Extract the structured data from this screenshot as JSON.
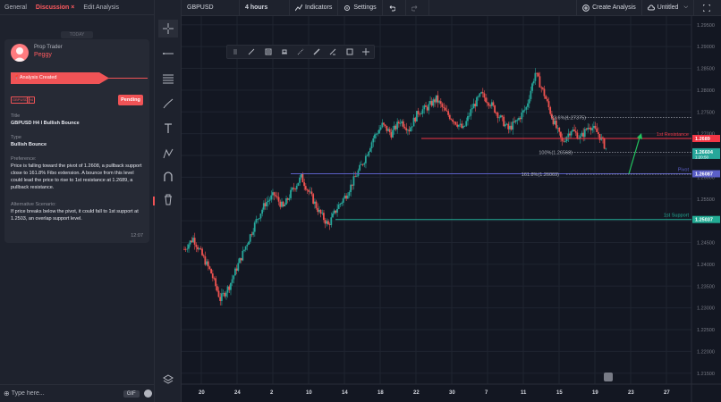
{
  "tabs": [
    {
      "label": "General"
    },
    {
      "label": "Discussion",
      "close": "×"
    },
    {
      "label": "Edit Analysis"
    }
  ],
  "today_label": "TODAY",
  "message": {
    "author_role": "Prop Trader",
    "author_name": "Peggy",
    "status_text": "Analysis Created",
    "tags": [
      "GBPUSD",
      "H4"
    ],
    "pending_label": "Pending",
    "title_label": "Title",
    "title": "GBPUSD H4 I Bullish Bounce",
    "type_label": "Type",
    "type": "Bullish Bounce",
    "preference_label": "Preference:",
    "preference": "Price is falling toward the pivot of 1.2608, a pullback support close to 161.8% Fibo extension. A bounce from this level could lead the price to rise to 1st resistance at 1.2689, a pullback resistance.",
    "alt_label": "Alternative Scenario:",
    "alt": "If price breaks below the pivot, it could fall to 1st support at 1.2503, an overlap support level.",
    "time": "12:07"
  },
  "input": {
    "placeholder": "Type here...",
    "gif_label": "GIF"
  },
  "topbar": {
    "symbol": "GBPUSD",
    "interval": "4 hours",
    "indicators": "Indicators",
    "settings": "Settings",
    "create_analysis": "Create Analysis",
    "layout_name": "Untitled"
  },
  "colors": {
    "resistance": "#f23645",
    "pivot": "#5b5fc7",
    "support": "#22ab94",
    "bull": "#26a69a",
    "bear": "#ef5350",
    "fib": "#b2b5be"
  },
  "chart_data": {
    "type": "candlestick",
    "symbol": "GBPUSD",
    "ylim": [
      1.2125,
      1.297
    ],
    "y_ticks": [
      "1.29500",
      "1.29000",
      "1.28500",
      "1.28000",
      "1.27500",
      "1.27000",
      "1.26500",
      "1.26000",
      "1.25500",
      "1.25000",
      "1.24500",
      "1.24000",
      "1.23500",
      "1.23000",
      "1.22500",
      "1.22000",
      "1.21500"
    ],
    "x_ticks": [
      "20",
      "24",
      "2",
      "10",
      "14",
      "18",
      "22",
      "30",
      "7",
      "11",
      "15",
      "19",
      "23",
      "27"
    ],
    "levels": [
      {
        "name": "1st Resistance",
        "price": 1.2689,
        "label": "1.2689"
      },
      {
        "name": "Pivot",
        "price": 1.2608,
        "label": "1.26087"
      },
      {
        "name": "1st Support",
        "price": 1.2503,
        "label": "1.25037"
      }
    ],
    "current_price": "1.26604",
    "current_time": "1:20:50",
    "fib_labels": [
      {
        "text": "23.6%(1.27375)",
        "price": 1.27375
      },
      {
        "text": "100%(1.26568)",
        "price": 1.26568
      },
      {
        "text": "161.8%(1.26069)",
        "price": 1.26069
      }
    ],
    "close_path": [
      1.2435,
      1.246,
      1.242,
      1.238,
      1.232,
      1.235,
      1.24,
      1.245,
      1.25,
      1.254,
      1.256,
      1.253,
      1.257,
      1.26,
      1.256,
      1.252,
      1.249,
      1.253,
      1.256,
      1.26,
      1.264,
      1.269,
      1.272,
      1.27,
      1.273,
      1.271,
      1.275,
      1.276,
      1.278,
      1.275,
      1.273,
      1.271,
      1.276,
      1.279,
      1.277,
      1.274,
      1.271,
      1.273,
      1.276,
      1.284,
      1.279,
      1.273,
      1.268,
      1.271,
      1.269,
      1.272,
      1.27,
      1.266
    ]
  }
}
